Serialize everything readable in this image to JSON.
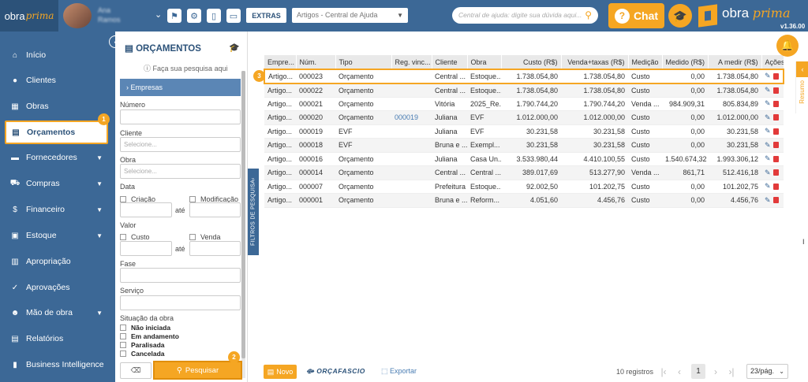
{
  "topbar": {
    "logo_prefix": "obra",
    "logo_suffix": "prima",
    "user_line1": "Ana",
    "user_line2": "Ramos",
    "extras_label": "EXTRAS",
    "help_select_value": "Artigos - Central de Ajuda",
    "help_search_placeholder": "Central de ajuda: digite sua dúvida aqui...",
    "chat_label": "Chat",
    "brand_prefix": "obra",
    "brand_suffix": "prima",
    "version": "v1.36.00"
  },
  "sidebar": {
    "items": [
      {
        "label": "Início",
        "icon": "home-icon",
        "glyph": "⌂",
        "has_arrow": false
      },
      {
        "label": "Clientes",
        "icon": "user-icon",
        "glyph": "●",
        "has_arrow": false
      },
      {
        "label": "Obras",
        "icon": "building-icon",
        "glyph": "▦",
        "has_arrow": false
      },
      {
        "label": "Orçamentos",
        "icon": "file-icon",
        "glyph": "▤",
        "has_arrow": false,
        "active": true
      },
      {
        "label": "Fornecedores",
        "icon": "truck-icon",
        "glyph": "▬",
        "has_arrow": true
      },
      {
        "label": "Compras",
        "icon": "cart-icon",
        "glyph": "⛟",
        "has_arrow": true
      },
      {
        "label": "Financeiro",
        "icon": "dollar-icon",
        "glyph": "$",
        "has_arrow": true
      },
      {
        "label": "Estoque",
        "icon": "box-icon",
        "glyph": "▣",
        "has_arrow": true
      },
      {
        "label": "Apropriação",
        "icon": "doc-icon",
        "glyph": "▥",
        "has_arrow": false
      },
      {
        "label": "Aprovações",
        "icon": "thumbs-up-icon",
        "glyph": "✓",
        "has_arrow": false
      },
      {
        "label": "Mão de obra",
        "icon": "workers-icon",
        "glyph": "☻",
        "has_arrow": true
      },
      {
        "label": "Relatórios",
        "icon": "report-icon",
        "glyph": "▤",
        "has_arrow": false
      },
      {
        "label": "Business Intelligence",
        "icon": "chart-icon",
        "glyph": "▮",
        "has_arrow": false
      }
    ],
    "step_badge": "1"
  },
  "filter": {
    "title": "ORÇAMENTOS",
    "hint": "Faça sua pesquisa aqui",
    "empresas_label": "Empresas",
    "numero_label": "Número",
    "cliente_label": "Cliente",
    "cliente_placeholder": "Selecione...",
    "obra_label": "Obra",
    "obra_placeholder": "Selecione...",
    "data_label": "Data",
    "criacao_label": "Criação",
    "modificacao_label": "Modificação",
    "ate_label": "até",
    "valor_label": "Valor",
    "custo_label": "Custo",
    "venda_label": "Venda",
    "fase_label": "Fase",
    "servico_label": "Serviço",
    "situacao_label": "Situação da obra",
    "situacao_options": [
      "Não iniciada",
      "Em andamento",
      "Paralisada",
      "Cancelada"
    ],
    "pesquisar_label": "Pesquisar",
    "step_badge": "2",
    "side_tab_label": "FILTROS DE PESQUISA"
  },
  "table": {
    "columns": [
      "Empre...",
      "Núm.",
      "Tipo",
      "Reg. vinc...",
      "Cliente",
      "Obra",
      "Custo (R$)",
      "Venda+taxas (R$)",
      "Medição",
      "Medido (R$)",
      "A medir (R$)",
      "Ações"
    ],
    "rows": [
      [
        "Artigo...",
        "000023",
        "Orçamento",
        "",
        "Central ...",
        "Estoque...",
        "1.738.054,80",
        "1.738.054,80",
        "Custo",
        "0,00",
        "1.738.054,80"
      ],
      [
        "Artigo...",
        "000022",
        "Orçamento",
        "",
        "Central ...",
        "Estoque...",
        "1.738.054,80",
        "1.738.054,80",
        "Custo",
        "0,00",
        "1.738.054,80"
      ],
      [
        "Artigo...",
        "000021",
        "Orçamento",
        "",
        "Vitória",
        "2025_Re...",
        "1.790.744,20",
        "1.790.744,20",
        "Venda ...",
        "984.909,31",
        "805.834,89"
      ],
      [
        "Artigo...",
        "000020",
        "Orçamento",
        "000019",
        "Juliana",
        "EVF",
        "1.012.000,00",
        "1.012.000,00",
        "Custo",
        "0,00",
        "1.012.000,00"
      ],
      [
        "Artigo...",
        "000019",
        "EVF",
        "",
        "Juliana",
        "EVF",
        "30.231,58",
        "30.231,58",
        "Custo",
        "0,00",
        "30.231,58"
      ],
      [
        "Artigo...",
        "000018",
        "EVF",
        "",
        "Bruna e ...",
        "Exempl...",
        "30.231,58",
        "30.231,58",
        "Custo",
        "0,00",
        "30.231,58"
      ],
      [
        "Artigo...",
        "000016",
        "Orçamento",
        "",
        "Juliana",
        "Casa Un...",
        "3.533.980,44",
        "4.410.100,55",
        "Custo",
        "1.540.674,32",
        "1.993.306,12"
      ],
      [
        "Artigo...",
        "000014",
        "Orçamento",
        "",
        "Central ...",
        "Central ...",
        "389.017,69",
        "513.277,90",
        "Venda ...",
        "861,71",
        "512.416,18"
      ],
      [
        "Artigo...",
        "000007",
        "Orçamento",
        "",
        "Prefeitura",
        "Estoque...",
        "92.002,50",
        "101.202,75",
        "Custo",
        "0,00",
        "101.202,75"
      ],
      [
        "Artigo...",
        "000001",
        "Orçamento",
        "",
        "Bruna e ...",
        "Reform...",
        "4.051,60",
        "4.456,76",
        "Custo",
        "0,00",
        "4.456,76"
      ]
    ],
    "step_badge": "3"
  },
  "footer": {
    "novo_label": "Novo",
    "orcafascio_label": "ORÇAFASCIO",
    "exportar_label": "Exportar",
    "registros": "10 registros",
    "current_page": "1",
    "per_page": "23/pág."
  },
  "right": {
    "resumo_label": "Resumo"
  },
  "colors": {
    "primary": "#3c6896",
    "accent": "#f5a623",
    "delete": "#e23a3a"
  }
}
